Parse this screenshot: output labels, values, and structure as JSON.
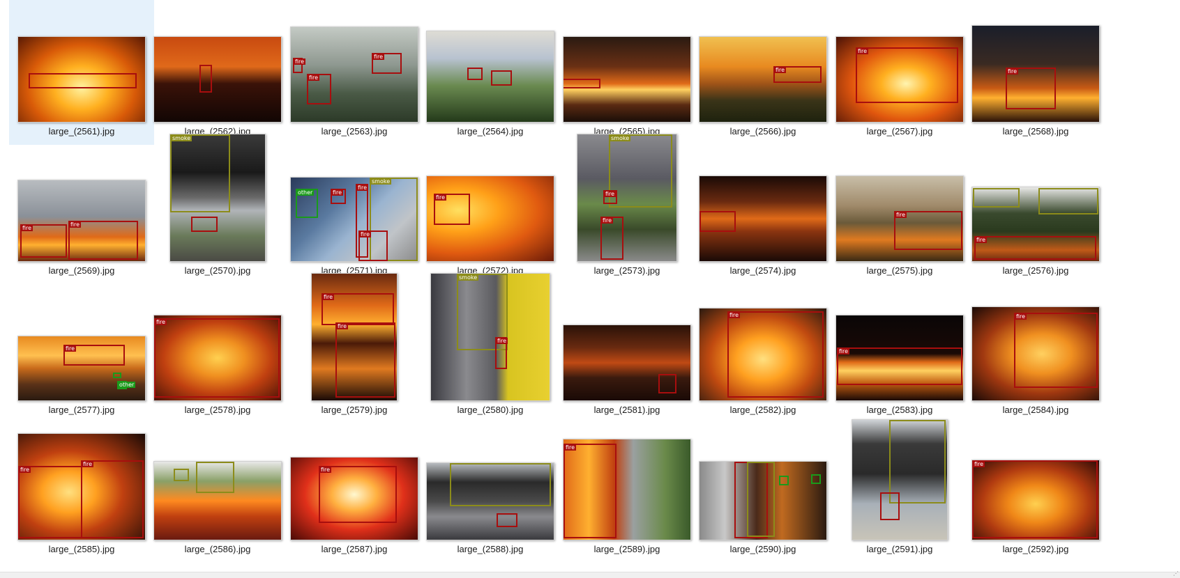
{
  "window": {
    "status_text": ""
  },
  "files": [
    {
      "name": "large_(2561).jpg",
      "selected": true,
      "w": 182,
      "h": 122,
      "bg": "radial-gradient(ellipse at 50% 60%, #fff2a0 0%, #ffb020 30%, #d85a08 60%, #5a1a04 100%)",
      "boxes": [
        {
          "label": "",
          "cls": "fire",
          "l": 15,
          "t": 52,
          "w": 155,
          "h": 22
        }
      ]
    },
    {
      "name": "large_(2562).jpg",
      "w": 182,
      "h": 122,
      "bg": "linear-gradient(180deg, #c84a10 0%, #e0691a 35%, #3a1208 55%, #120604 100%)",
      "boxes": [
        {
          "label": "",
          "cls": "fire",
          "l": 65,
          "t": 40,
          "w": 18,
          "h": 40
        }
      ]
    },
    {
      "name": "large_(2563).jpg",
      "w": 182,
      "h": 136,
      "bg": "linear-gradient(180deg, #c4cac4 0%, #8e9890 40%, #4a5a46 70%, #2c3a28 100%)",
      "boxes": [
        {
          "label": "fire",
          "cls": "fire",
          "l": 3,
          "t": 44,
          "w": 14,
          "h": 22
        },
        {
          "label": "fire",
          "cls": "fire",
          "l": 23,
          "t": 67,
          "w": 35,
          "h": 44
        },
        {
          "label": "fire",
          "cls": "fire",
          "l": 116,
          "t": 37,
          "w": 43,
          "h": 30
        }
      ]
    },
    {
      "name": "large_(2564).jpg",
      "w": 182,
      "h": 130,
      "bg": "linear-gradient(180deg, #dedcd4 0%, #b8c2d0 30%, #6a8a50 60%, #243a1a 100%)",
      "boxes": [
        {
          "label": "",
          "cls": "fire",
          "l": 58,
          "t": 52,
          "w": 22,
          "h": 18
        },
        {
          "label": "",
          "cls": "fire",
          "l": 92,
          "t": 56,
          "w": 30,
          "h": 22
        }
      ]
    },
    {
      "name": "large_(2565).jpg",
      "w": 182,
      "h": 122,
      "bg": "linear-gradient(180deg, #2a1a12 0%, #6a3014 35%, #e06a18 55%, #ffd060 62%, #5a2a12 80%, #1a0e08 100%)",
      "boxes": [
        {
          "label": "",
          "cls": "fire",
          "l": -2,
          "t": 60,
          "w": 55,
          "h": 14
        }
      ]
    },
    {
      "name": "large_(2566).jpg",
      "w": 182,
      "h": 122,
      "bg": "linear-gradient(180deg, #f0c050 0%, #e88a20 35%, #a05418 55%, #3a3418 75%, #1e220e 100%)",
      "boxes": [
        {
          "label": "fire",
          "cls": "fire",
          "l": 106,
          "t": 42,
          "w": 69,
          "h": 24
        }
      ]
    },
    {
      "name": "large_(2567).jpg",
      "w": 182,
      "h": 122,
      "bg": "radial-gradient(ellipse at 55% 55%, #fff4b0 0%, #ffb020 25%, #e0560e 55%, #4a1206 100%)",
      "boxes": [
        {
          "label": "fire",
          "cls": "fire",
          "l": 28,
          "t": 15,
          "w": 147,
          "h": 80
        }
      ]
    },
    {
      "name": "large_(2568).jpg",
      "w": 182,
      "h": 138,
      "bg": "linear-gradient(180deg, #1a1e2a 0%, #3a2a22 40%, #c85a14 65%, #ffb030 75%, #2a1208 100%)",
      "boxes": [
        {
          "label": "fire",
          "cls": "fire",
          "l": 48,
          "t": 60,
          "w": 72,
          "h": 60
        }
      ]
    },
    {
      "name": "large_(2569).jpg",
      "w": 182,
      "h": 116,
      "bg": "linear-gradient(180deg, #b8bcc0 0%, #8a9098 45%, #e06a18 70%, #ffb030 80%, #6a2a10 100%)",
      "boxes": [
        {
          "label": "fire",
          "cls": "fire",
          "l": 3,
          "t": 63,
          "w": 67,
          "h": 48
        },
        {
          "label": "fire",
          "cls": "fire",
          "l": 72,
          "t": 58,
          "w": 100,
          "h": 56
        }
      ]
    },
    {
      "name": "large_(2570).jpg",
      "w": 136,
      "h": 182,
      "bg": "linear-gradient(180deg, #3a3a3a 0%, #1a1a1a 30%, #6a6a6a 50%, #b0b4b8 60%, #6a7a5a 80%, #4a4a44 100%)",
      "boxes": [
        {
          "label": "smoke",
          "cls": "smoke",
          "l": 0,
          "t": 0,
          "w": 86,
          "h": 112
        },
        {
          "label": "",
          "cls": "fire",
          "l": 30,
          "t": 118,
          "w": 38,
          "h": 22
        }
      ]
    },
    {
      "name": "large_(2571).jpg",
      "w": 182,
      "h": 120,
      "bg": "linear-gradient(135deg, #2a3a5a 0%, #5a7aa0 35%, #9ab4d0 55%, #c0c4c8 75%, #8a8a8a 100%)",
      "boxes": [
        {
          "label": "other",
          "cls": "other",
          "l": 7,
          "t": 16,
          "w": 32,
          "h": 42
        },
        {
          "label": "fire",
          "cls": "fire",
          "l": 57,
          "t": 16,
          "w": 22,
          "h": 22
        },
        {
          "label": "fire",
          "cls": "fire",
          "l": 93,
          "t": 9,
          "w": 18,
          "h": 106
        },
        {
          "label": "smoke",
          "cls": "smoke",
          "l": 113,
          "t": 0,
          "w": 69,
          "h": 120
        },
        {
          "label": "fire",
          "cls": "fire",
          "l": 97,
          "t": 76,
          "w": 42,
          "h": 44
        }
      ]
    },
    {
      "name": "large_(2572).jpg",
      "w": 182,
      "h": 122,
      "bg": "radial-gradient(ellipse at 25% 40%, #ffe060 0%, #ffa018 30%, #e05a10 60%, #6a1a08 100%)",
      "boxes": [
        {
          "label": "fire",
          "cls": "fire",
          "l": 10,
          "t": 25,
          "w": 52,
          "h": 45
        }
      ]
    },
    {
      "name": "large_(2573).jpg",
      "w": 142,
      "h": 182,
      "bg": "linear-gradient(180deg, #8a8a8e 0%, #5a5a62 35%, #6a8a4a 55%, #3a4a2a 75%, #8a8a8a 100%)",
      "boxes": [
        {
          "label": "smoke",
          "cls": "smoke",
          "l": 45,
          "t": 0,
          "w": 91,
          "h": 105
        },
        {
          "label": "fire",
          "cls": "fire",
          "l": 37,
          "t": 80,
          "w": 20,
          "h": 20
        },
        {
          "label": "fire",
          "cls": "fire",
          "l": 33,
          "t": 118,
          "w": 33,
          "h": 62
        }
      ]
    },
    {
      "name": "large_(2574).jpg",
      "w": 182,
      "h": 122,
      "bg": "linear-gradient(180deg, #1a0a06 0%, #6a2a10 30%, #e06a18 50%, #8a3410 65%, #1a0a06 100%)",
      "boxes": [
        {
          "label": "",
          "cls": "fire",
          "l": 0,
          "t": 50,
          "w": 52,
          "h": 30
        }
      ]
    },
    {
      "name": "large_(2575).jpg",
      "w": 182,
      "h": 122,
      "bg": "linear-gradient(180deg, #c8bea8 0%, #a08a6a 35%, #6a5a3a 55%, #e07a20 75%, #3a2a14 100%)",
      "boxes": [
        {
          "label": "fire",
          "cls": "fire",
          "l": 83,
          "t": 50,
          "w": 98,
          "h": 56
        }
      ]
    },
    {
      "name": "large_(2576).jpg",
      "w": 182,
      "h": 106,
      "bg": "linear-gradient(180deg, #e8e8e6 0%, #3a4a2e 35%, #2a3a1e 60%, #c05a18 85%, #6a2a10 100%)",
      "boxes": [
        {
          "label": "",
          "cls": "smoke",
          "l": 1,
          "t": 1,
          "w": 67,
          "h": 28
        },
        {
          "label": "",
          "cls": "smoke",
          "l": 95,
          "t": 1,
          "w": 86,
          "h": 38
        },
        {
          "label": "fire",
          "cls": "fire",
          "l": 3,
          "t": 70,
          "w": 175,
          "h": 34
        }
      ]
    },
    {
      "name": "large_(2577).jpg",
      "w": 182,
      "h": 92,
      "bg": "linear-gradient(180deg, #e88a20 0%, #ffc050 30%, #c86a1a 50%, #5a3218 75%, #2a1a10 100%)",
      "boxes": [
        {
          "label": "fire",
          "cls": "fire",
          "l": 65,
          "t": 12,
          "w": 88,
          "h": 30
        },
        {
          "label": "",
          "cls": "other",
          "l": 136,
          "t": 52,
          "w": 12,
          "h": 8
        },
        {
          "label": "other",
          "cls": "other",
          "l": 142,
          "t": 64,
          "w": 14,
          "h": 12
        }
      ]
    },
    {
      "name": "large_(2578).jpg",
      "w": 182,
      "h": 122,
      "bg": "radial-gradient(ellipse at 50% 50%, #ffd050 0%, #f09020 30%, #c04010 60%, #4a1206 100%)",
      "boxes": [
        {
          "label": "fire",
          "cls": "fire",
          "l": 0,
          "t": 4,
          "w": 180,
          "h": 114
        }
      ]
    },
    {
      "name": "large_(2579).jpg",
      "w": 122,
      "h": 182,
      "bg": "linear-gradient(180deg, #6a2a10 0%, #e06a18 25%, #ffb030 40%, #4a1a08 55%, #e07a20 75%, #1a0a06 100%)",
      "boxes": [
        {
          "label": "fire",
          "cls": "fire",
          "l": 14,
          "t": 28,
          "w": 104,
          "h": 46
        },
        {
          "label": "fire",
          "cls": "fire",
          "l": 34,
          "t": 70,
          "w": 86,
          "h": 108
        }
      ]
    },
    {
      "name": "large_(2580).jpg",
      "w": 170,
      "h": 182,
      "bg": "linear-gradient(90deg, #3a3a40 0%, #8a8a8e 30%, #5a5a5e 55%, #d8c420 65%, #e8d030 100%)",
      "boxes": [
        {
          "label": "smoke",
          "cls": "smoke",
          "l": 37,
          "t": 0,
          "w": 73,
          "h": 110
        },
        {
          "label": "fire",
          "cls": "fire",
          "l": 92,
          "t": 91,
          "w": 17,
          "h": 46
        }
      ]
    },
    {
      "name": "large_(2581).jpg",
      "w": 182,
      "h": 108,
      "bg": "linear-gradient(180deg, #2a1208 0%, #6a2a10 30%, #c04a14 50%, #3a1a0e 70%, #1a0a06 100%)",
      "boxes": [
        {
          "label": "",
          "cls": "fire",
          "l": 136,
          "t": 70,
          "w": 26,
          "h": 28
        }
      ]
    },
    {
      "name": "large_(2582).jpg",
      "w": 182,
      "h": 132,
      "bg": "radial-gradient(ellipse at 50% 55%, #ffe080 0%, #ffa020 30%, #c04a10 60%, #2a1a10 100%)",
      "boxes": [
        {
          "label": "fire",
          "cls": "fire",
          "l": 40,
          "t": 4,
          "w": 138,
          "h": 124
        }
      ]
    },
    {
      "name": "large_(2583).jpg",
      "w": 182,
      "h": 122,
      "bg": "linear-gradient(180deg, #0a0606 0%, #1a0a06 45%, #e06a18 55%, #ffd060 65%, #c05a10 80%, #1a0a06 100%)",
      "boxes": [
        {
          "label": "fire",
          "cls": "fire",
          "l": 1,
          "t": 46,
          "w": 180,
          "h": 54
        }
      ]
    },
    {
      "name": "large_(2584).jpg",
      "w": 182,
      "h": 134,
      "bg": "radial-gradient(ellipse at 55% 50%, #ffd060 0%, #f09020 30%, #a03810 60%, #1a0a06 100%)",
      "boxes": [
        {
          "label": "fire",
          "cls": "fire",
          "l": 60,
          "t": 8,
          "w": 120,
          "h": 108
        }
      ]
    },
    {
      "name": "large_(2585).jpg",
      "w": 182,
      "h": 152,
      "bg": "radial-gradient(ellipse at 40% 55%, #ffe080 0%, #ffa020 25%, #c04010 50%, #1a0a06 100%)",
      "boxes": [
        {
          "label": "fire",
          "cls": "fire",
          "l": 0,
          "t": 46,
          "w": 92,
          "h": 104
        },
        {
          "label": "fire",
          "cls": "fire",
          "l": 90,
          "t": 38,
          "w": 90,
          "h": 112
        }
      ]
    },
    {
      "name": "large_(2586).jpg",
      "w": 182,
      "h": 112,
      "bg": "linear-gradient(180deg, #e8e8e8 0%, #8aa068 25%, #ff8a20 50%, #c04010 70%, #6a1a10 100%)",
      "boxes": [
        {
          "label": "",
          "cls": "smoke",
          "l": 28,
          "t": 10,
          "w": 22,
          "h": 18
        },
        {
          "label": "",
          "cls": "smoke",
          "l": 60,
          "t": 0,
          "w": 55,
          "h": 45
        }
      ]
    },
    {
      "name": "large_(2587).jpg",
      "w": 182,
      "h": 118,
      "bg": "radial-gradient(ellipse at 50% 45%, #fff8d0 0%, #ffb040 25%, #e0301a 55%, #4a0a06 100%)",
      "boxes": [
        {
          "label": "fire",
          "cls": "fire",
          "l": 40,
          "t": 12,
          "w": 112,
          "h": 82
        }
      ]
    },
    {
      "name": "large_(2588).jpg",
      "w": 182,
      "h": 110,
      "bg": "linear-gradient(180deg, #b8bcc0 0%, #2a2a2a 25%, #4a4a4a 50%, #8a8a8e 70%, #3a3a3e 100%)",
      "boxes": [
        {
          "label": "",
          "cls": "smoke",
          "l": 33,
          "t": 0,
          "w": 145,
          "h": 62
        },
        {
          "label": "",
          "cls": "fire",
          "l": 100,
          "t": 72,
          "w": 30,
          "h": 20
        }
      ]
    },
    {
      "name": "large_(2589).jpg",
      "w": 182,
      "h": 144,
      "bg": "linear-gradient(90deg, #e06a18 0%, #ffb030 20%, #c04010 40%, #9aa0a0 55%, #6a8a4a 80%, #3a5a2a 100%)",
      "boxes": [
        {
          "label": "fire",
          "cls": "fire",
          "l": 0,
          "t": 6,
          "w": 76,
          "h": 136
        }
      ]
    },
    {
      "name": "large_(2590).jpg",
      "w": 182,
      "h": 112,
      "bg": "linear-gradient(90deg, #8a8a8a 0%, #c8c8c8 20%, #4a2a1a 45%, #c06a20 65%, #2a1a10 100%)",
      "boxes": [
        {
          "label": "",
          "cls": "fire",
          "l": 50,
          "t": 0,
          "w": 48,
          "h": 110
        },
        {
          "label": "",
          "cls": "smoke",
          "l": 68,
          "t": 0,
          "w": 40,
          "h": 108
        },
        {
          "label": "",
          "cls": "other",
          "l": 114,
          "t": 20,
          "w": 14,
          "h": 14
        },
        {
          "label": "",
          "cls": "other",
          "l": 160,
          "t": 18,
          "w": 14,
          "h": 14
        }
      ]
    },
    {
      "name": "large_(2591).jpg",
      "w": 136,
      "h": 172,
      "bg": "linear-gradient(180deg, #d0d4d8 0%, #3a3a3a 20%, #2a2a2a 45%, #a8b0b8 70%, #c8c4b8 100%)",
      "boxes": [
        {
          "label": "",
          "cls": "smoke",
          "l": 53,
          "t": 0,
          "w": 81,
          "h": 120
        },
        {
          "label": "",
          "cls": "fire",
          "l": 40,
          "t": 104,
          "w": 28,
          "h": 40
        }
      ]
    },
    {
      "name": "large_(2592).jpg",
      "w": 182,
      "h": 114,
      "bg": "radial-gradient(ellipse at 50% 55%, #ffd050 0%, #f08818 30%, #b03a10 60%, #2a0a06 100%)",
      "boxes": [
        {
          "label": "fire",
          "cls": "fire",
          "l": 0,
          "t": 0,
          "w": 180,
          "h": 112
        }
      ]
    }
  ]
}
